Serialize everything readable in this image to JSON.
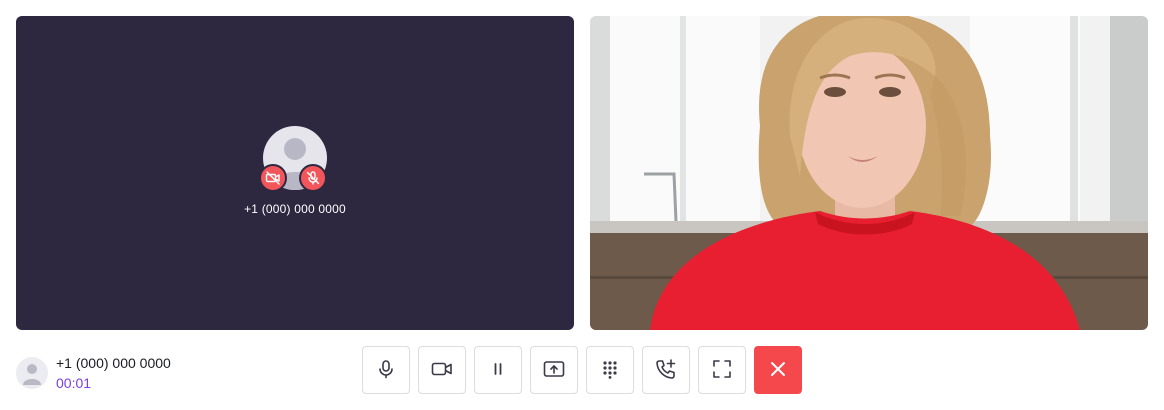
{
  "remote": {
    "number": "+1 (000) 000 0000",
    "camera_status": "camera-off",
    "mic_status": "mic-muted"
  },
  "footer": {
    "number": "+1 (000) 000 0000",
    "timer": "00:01"
  },
  "controls": [
    {
      "name": "microphone",
      "icon": "microphone-icon"
    },
    {
      "name": "camera",
      "icon": "video-camera-icon"
    },
    {
      "name": "hold",
      "icon": "pause-icon"
    },
    {
      "name": "share-screen",
      "icon": "screen-share-icon"
    },
    {
      "name": "dialpad",
      "icon": "dialpad-icon"
    },
    {
      "name": "add-call",
      "icon": "add-call-icon"
    },
    {
      "name": "fullscreen",
      "icon": "fullscreen-icon"
    },
    {
      "name": "hang-up",
      "icon": "close-icon"
    }
  ],
  "colors": {
    "remote_bg": "#2d2840",
    "badge_red": "#f2555a",
    "timer": "#7b3fe4",
    "hangup": "#f5484d"
  }
}
